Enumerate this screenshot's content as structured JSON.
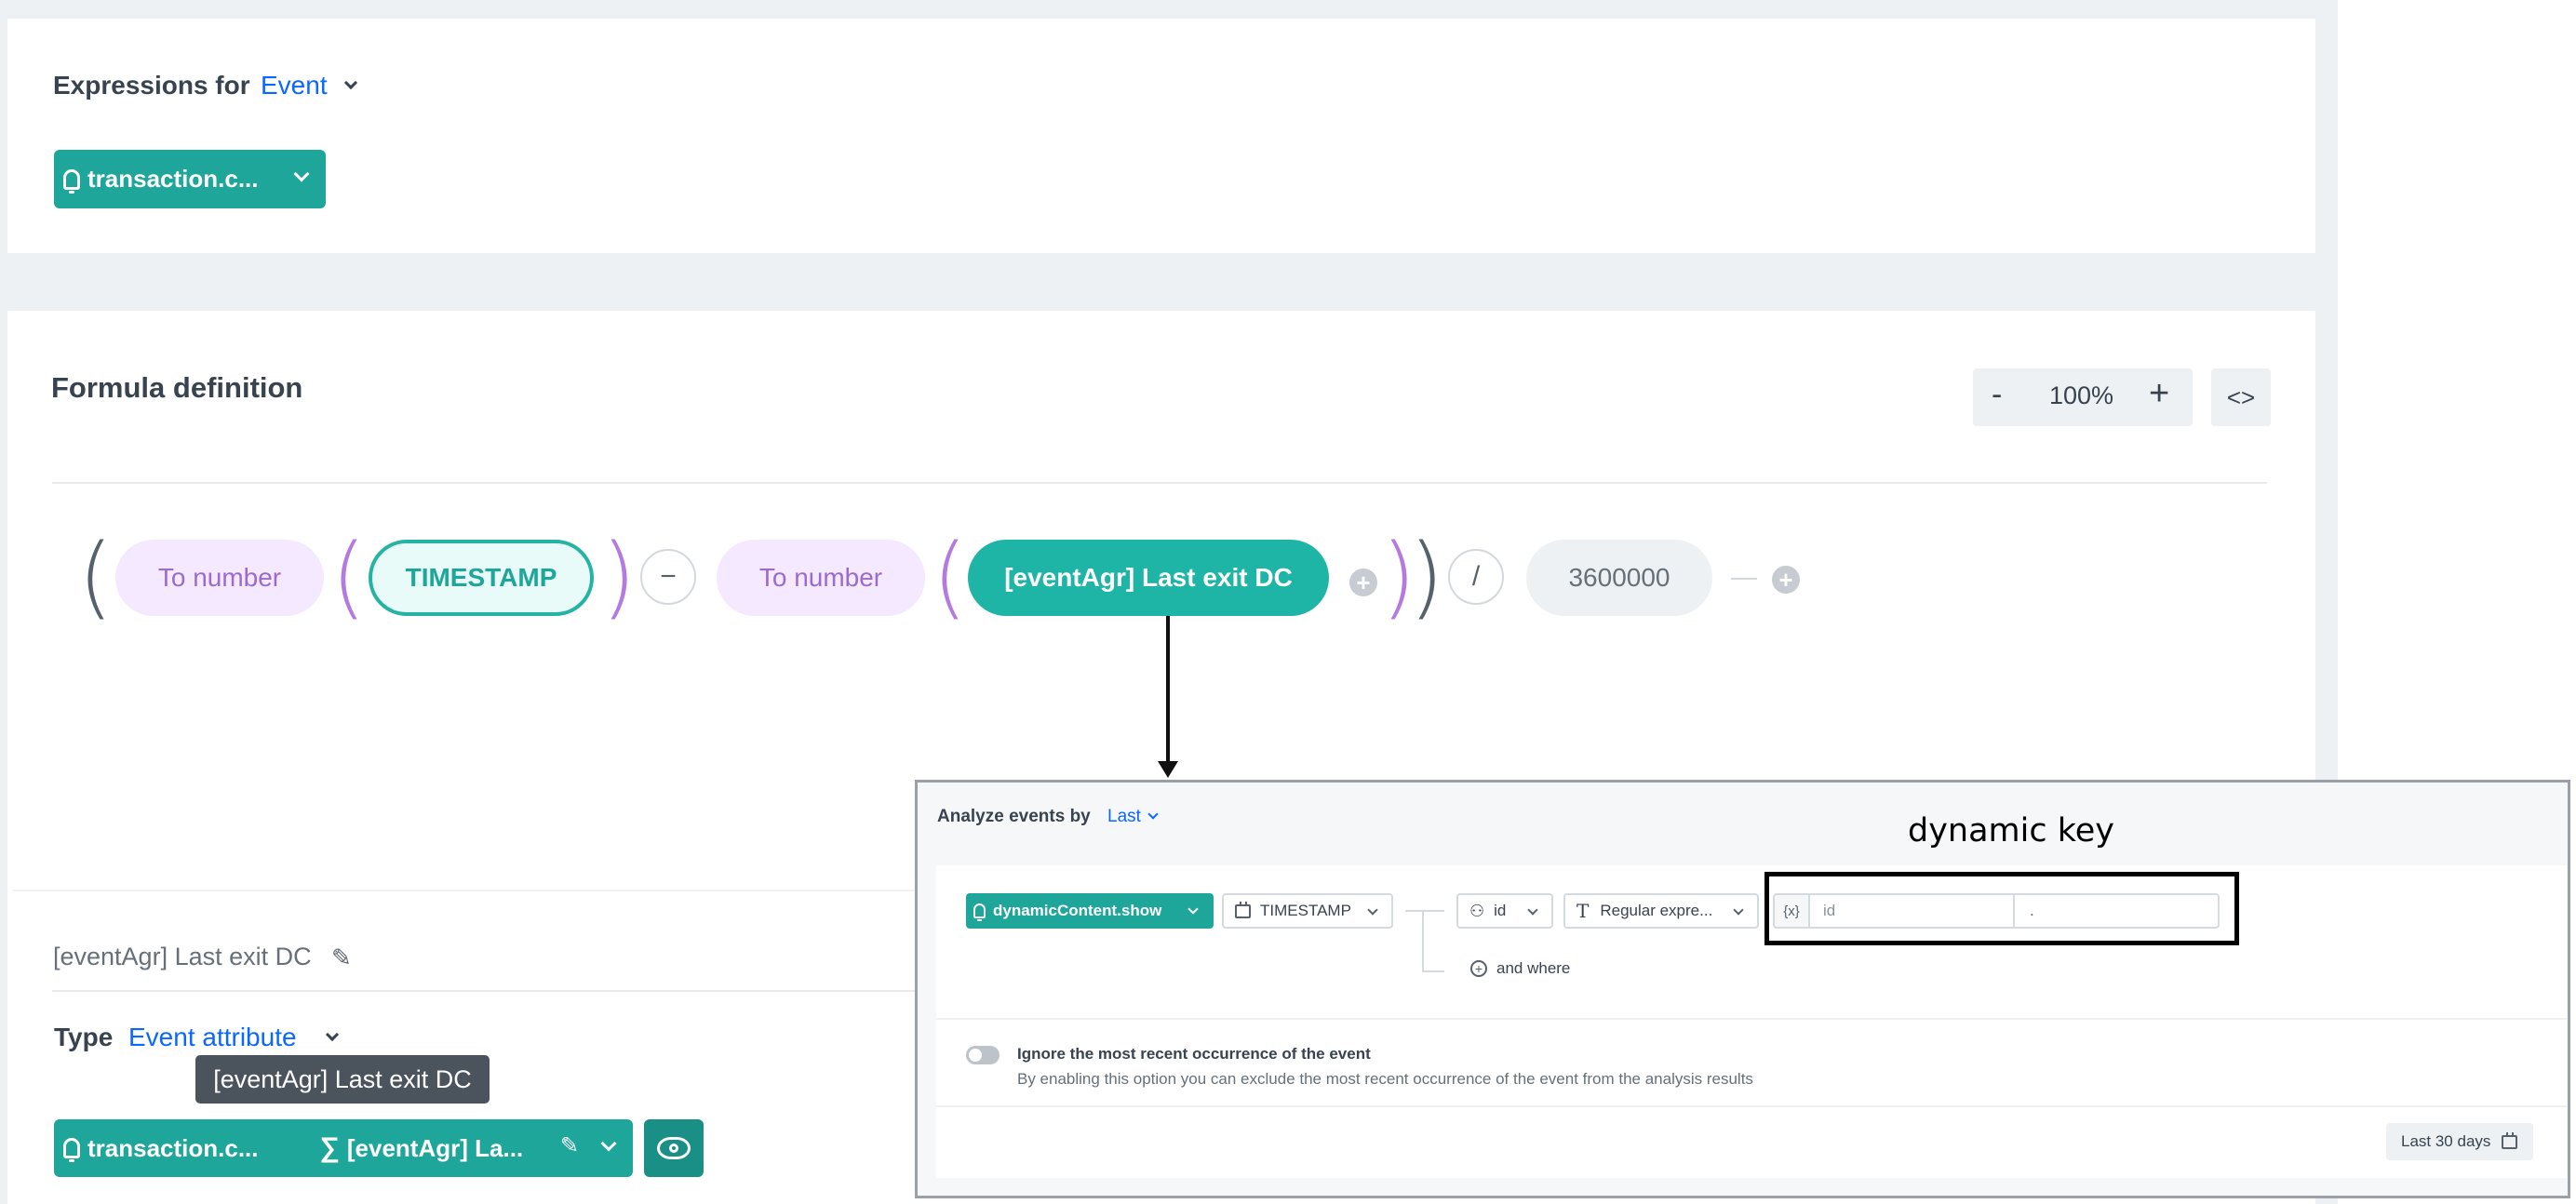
{
  "expressions": {
    "label": "Expressions for",
    "type_value": "Event",
    "event_button": "transaction.c..."
  },
  "formula": {
    "title": "Formula definition",
    "zoom": {
      "minus": "-",
      "value": "100%",
      "plus": "+",
      "code_toggle": "<>"
    },
    "tokens": {
      "func1": "To number",
      "timestamp": "TIMESTAMP",
      "op_minus": "−",
      "func2": "To number",
      "attr": "[eventAgr] Last exit DC",
      "op_divide": "/",
      "number": "3600000"
    }
  },
  "details": {
    "attr_name": "[eventAgr] Last exit DC",
    "type_label": "Type",
    "type_value": "Event attribute",
    "tooltip": "[eventAgr] Last exit DC",
    "event_button": "transaction.c...",
    "attr_button": "[eventAgr] La..."
  },
  "popup": {
    "analyze_label": "Analyze events by",
    "analyze_value": "Last",
    "event_button": "dynamicContent.show",
    "timestamp_select": "TIMESTAMP",
    "id_select": "id",
    "regex_select": "Regular expre...",
    "var_badge": "{x}",
    "key_input": "id",
    "value_input": ".",
    "and_where": "and where",
    "ignore_title": "Ignore the most recent occurrence of the event",
    "ignore_desc": "By enabling this option you can exclude the most recent occurrence of the event from the analysis results",
    "date_range": "Last 30 days"
  },
  "annotation": {
    "label": "dynamic key"
  },
  "colors": {
    "teal": "#1fa69a",
    "link_blue": "#0b68ff",
    "purple": "#b57ae0"
  }
}
